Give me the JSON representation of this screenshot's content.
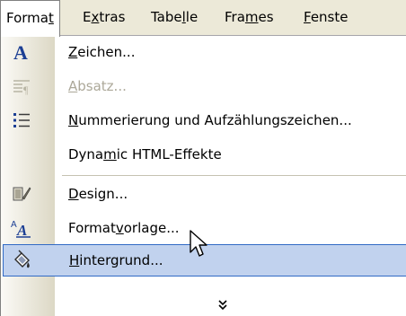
{
  "menubar": {
    "items": [
      {
        "label_pre": "Forma",
        "label_u": "t",
        "label_post": "",
        "active": true
      },
      {
        "label_pre": "E",
        "label_u": "x",
        "label_post": "tras"
      },
      {
        "label_pre": "Tabe",
        "label_u": "l",
        "label_post": "le"
      },
      {
        "label_pre": "Fra",
        "label_u": "m",
        "label_post": "es"
      },
      {
        "label_pre": "",
        "label_u": "F",
        "label_post": "enste"
      }
    ]
  },
  "menu": {
    "items": [
      {
        "id": "zeichen",
        "u": "Z",
        "rest": "eichen...",
        "pre": "",
        "icon": "font-a-icon"
      },
      {
        "id": "absatz",
        "u": "A",
        "rest": "bsatz...",
        "pre": "",
        "icon": "paragraph-icon",
        "disabled": true
      },
      {
        "id": "nummerierung",
        "u": "N",
        "rest": "ummerierung und Aufzählungszeichen...",
        "pre": "",
        "icon": "bullet-list-icon"
      },
      {
        "id": "dynamic",
        "pre": "Dyna",
        "u": "m",
        "rest": "ic HTML-Effekte",
        "icon": ""
      },
      {
        "id": "design",
        "u": "D",
        "rest": "esign...",
        "pre": "",
        "icon": "theme-brush-icon"
      },
      {
        "id": "formatvorlage",
        "pre": "Format",
        "u": "v",
        "rest": "orlage...",
        "icon": "style-a-icon"
      },
      {
        "id": "hintergrund",
        "u": "H",
        "rest": "intergrund...",
        "pre": "",
        "icon": "paint-bucket-icon",
        "hover": true
      }
    ]
  },
  "colors": {
    "menubar_bg": "#ece9d8",
    "hover_bg": "#c1d2ee",
    "hover_border": "#316ac5",
    "disabled_text": "#aca899"
  }
}
